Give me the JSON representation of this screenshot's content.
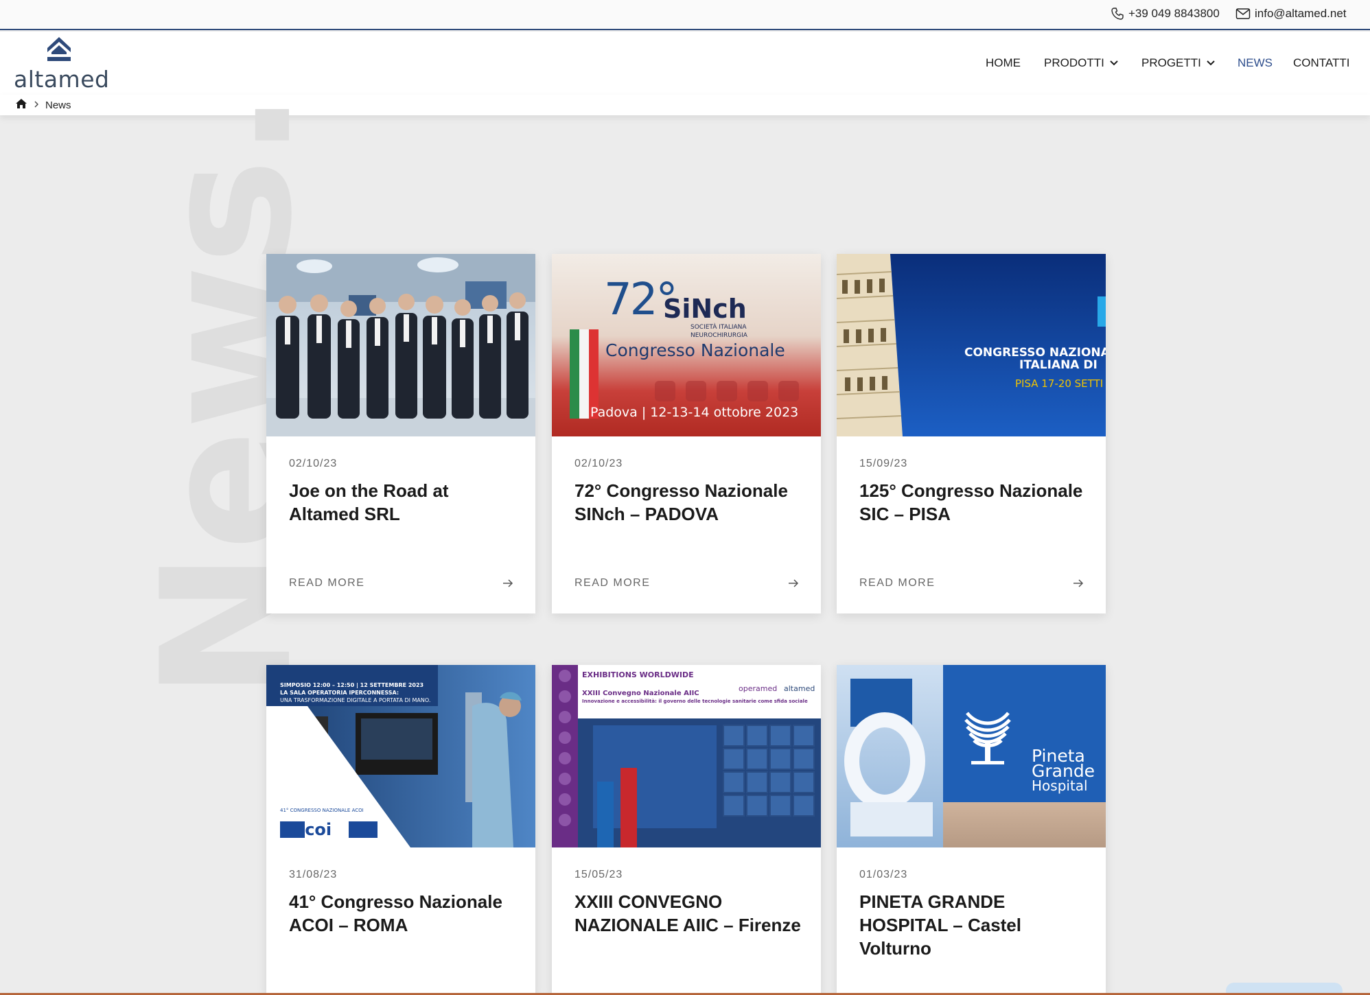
{
  "topbar": {
    "phone": "+39 049 8843800",
    "email": "info@altamed.net"
  },
  "brand": {
    "name": "altamed"
  },
  "nav": {
    "home": "HOME",
    "prodotti": "PRODOTTI",
    "progetti": "PROGETTI",
    "news": "NEWS",
    "contatti": "CONTATTI",
    "active": "NEWS",
    "active_color": "#2d4d8c"
  },
  "breadcrumb": {
    "current": "News"
  },
  "background_word": "News.",
  "read_more_label": "READ MORE",
  "cards": [
    {
      "date": "02/10/23",
      "title": "Joe on the Road at Altamed SRL",
      "image": "group-photo-operating-room"
    },
    {
      "date": "02/10/23",
      "title": "72° Congresso Nazionale SINch – PADOVA",
      "image": "sinch-congress-banner",
      "image_text": {
        "number": "72°",
        "logo": "SiNch",
        "org_line1": "SOCIETÀ ITALIANA",
        "org_line2": "NEUROCHIRURGIA",
        "subtitle": "Congresso Nazionale",
        "place": "Padova | 12-13-14 ottobre 2023"
      }
    },
    {
      "date": "15/09/23",
      "title": "125° Congresso Nazionale SIC – PISA",
      "image": "pisa-tower-banner",
      "image_text": {
        "line1": "CONGRESSO NAZIONA",
        "line2": "ITALIANA DI",
        "line3": "PISA 17-20 SETTI"
      }
    },
    {
      "date": "31/08/23",
      "title": "41° Congresso Nazionale ACOI – ROMA",
      "image": "acoi-symposium-banner",
      "image_text": {
        "line1": "SIMPOSIO 12:00 – 12:50 | 12 SETTEMBRE 2023",
        "line2": "LA SALA OPERATORIA IPERCONNESSA:",
        "line3": "UNA TRASFORMAZIONE DIGITALE A PORTATA DI MANO.",
        "congress": "41° CONGRESSO NAZIONALE ACOI",
        "logo": "acoi"
      }
    },
    {
      "date": "15/05/23",
      "title": "XXIII CONVEGNO NAZIONALE AIIC – Firenze",
      "image": "aiic-exhibition-banner",
      "image_text": {
        "header": "EXHIBITIONS WORLDWIDE",
        "brand1": "operamed",
        "brand2": "altamed",
        "line1": "XXIII Convegno Nazionale AIIC",
        "line2": "Innovazione e accessibilità: il governo delle tecnologie sanitarie come sfida sociale"
      }
    },
    {
      "date": "01/03/23",
      "title": "PINETA GRANDE HOSPITAL – Castel Volturno",
      "image": "pineta-grande-hospital",
      "image_text": {
        "line1": "Pineta",
        "line2": "Grande",
        "line3": "Hospital"
      }
    }
  ],
  "colors": {
    "brand_blue": "#2e4a7a",
    "page_bg": "#ececec",
    "card_bg": "#ffffff"
  }
}
